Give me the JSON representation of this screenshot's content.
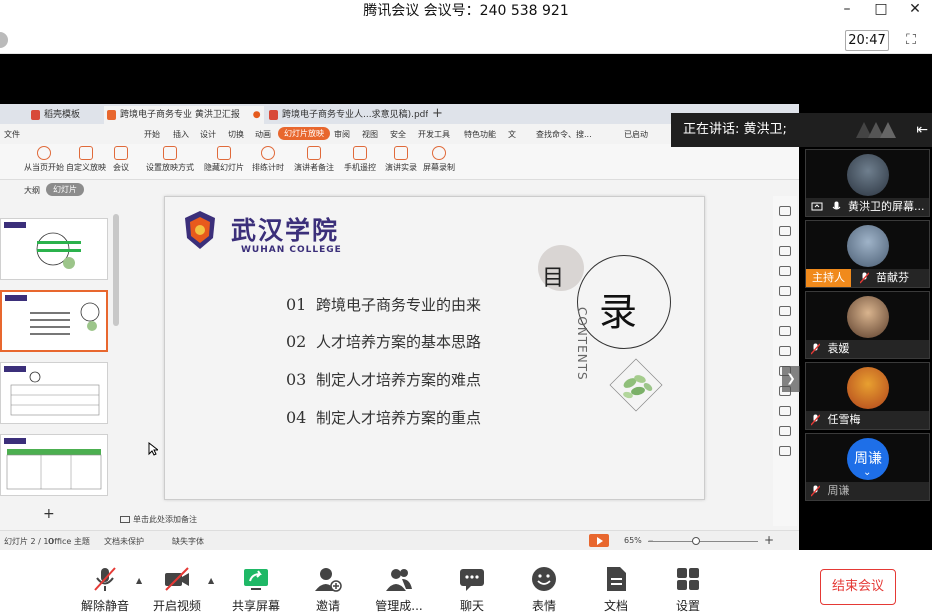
{
  "window": {
    "title": "腾讯会议 会议号：240 538 921",
    "minimize": "–",
    "maximize": "□",
    "close": "✕"
  },
  "topbar": {
    "clock": "20:47",
    "fullscreen_icon": "fullscreen-icon"
  },
  "wps": {
    "tabs": [
      {
        "label": "稻壳模板",
        "color": "#d84a3a"
      },
      {
        "label": "跨境电子商务专业  黄洪卫汇报",
        "color": "#e8672e",
        "dot": "●"
      },
      {
        "label": "跨境电子商务专业人...求意见稿).pdf",
        "color": "#d84a3a"
      }
    ],
    "new_tab": "+",
    "menu": {
      "file": "文件",
      "items": [
        "开始",
        "插入",
        "设计",
        "切换",
        "动画",
        "幻灯片放映",
        "审阅",
        "视图",
        "安全",
        "开发工具",
        "特色功能",
        "文"
      ],
      "search": "查找命令、搜...",
      "cloud": "已启动"
    },
    "ribbon": [
      "从当页开始",
      "自定义放映",
      "会议",
      "设置放映方式",
      "隐藏幻灯片",
      "排练计时",
      "演讲者备注",
      "手机遥控",
      "演讲实录",
      "屏幕录制"
    ],
    "pane": {
      "outline": "大纲",
      "slides": "幻灯片"
    },
    "add_slide": "+",
    "notes_placeholder": "单击此处添加备注",
    "status": {
      "page": "幻灯片 2 / 10",
      "theme": "Office 主题",
      "backup": "文档未保护",
      "font": "缺失字体",
      "zoom": "65%",
      "zoom_minus": "–",
      "zoom_plus": "+",
      "zoom_value": 0.65
    }
  },
  "slide": {
    "school_cn": "武汉学院",
    "school_en": "WUHAN COLLEGE",
    "mu": "目",
    "lu": "录",
    "contents": "CONTENTS",
    "items": [
      {
        "num": "01",
        "text": "跨境电子商务专业的由来"
      },
      {
        "num": "02",
        "text": "人才培养方案的基本思路"
      },
      {
        "num": "03",
        "text": "制定人才培养方案的难点"
      },
      {
        "num": "04",
        "text": "制定人才培养方案的重点"
      }
    ]
  },
  "speaking": {
    "label": "正在讲话: 黄洪卫;"
  },
  "participants": [
    {
      "name": "黄洪卫的屏幕...",
      "role": "",
      "sharing": true
    },
    {
      "name": "苗献芬",
      "role": "主持人"
    },
    {
      "name": "袁媛",
      "role": ""
    },
    {
      "name": "任雪梅",
      "role": ""
    },
    {
      "name": "周谦",
      "role": "",
      "initial": "周谦"
    }
  ],
  "controls": {
    "mute": "解除静音",
    "video": "开启视频",
    "share": "共享屏幕",
    "invite": "邀请",
    "manage": "管理成...",
    "chat": "聊天",
    "reactions": "表情",
    "docs": "文档",
    "settings": "设置",
    "end": "结束会议"
  },
  "colors": {
    "accent_orange": "#e8672e",
    "end_red": "#e53935",
    "host_orange": "#f08a1c",
    "share_green": "#1fb866",
    "school_purple": "#3b2f7a"
  }
}
